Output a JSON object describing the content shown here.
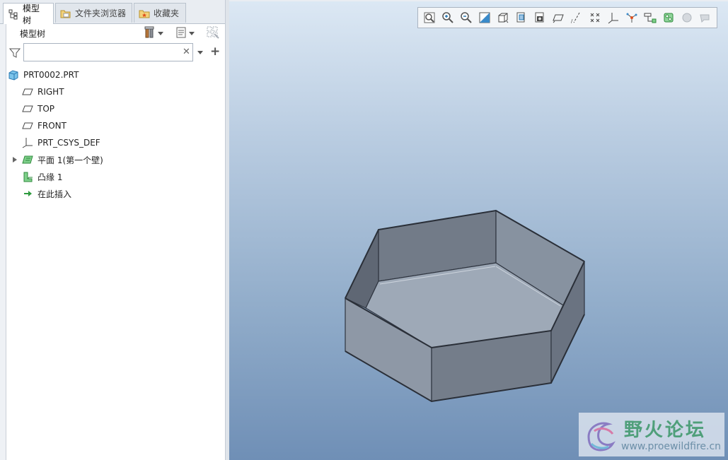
{
  "tabs": [
    {
      "label": "模型树",
      "icon": "model-tree-icon",
      "active": true
    },
    {
      "label": "文件夹浏览器",
      "icon": "folder-browser-icon",
      "active": false
    },
    {
      "label": "收藏夹",
      "icon": "favorites-icon",
      "active": false
    }
  ],
  "model_tree": {
    "title": "模型树",
    "search": {
      "value": "",
      "placeholder": ""
    },
    "items": [
      {
        "label": "PRT0002.PRT",
        "icon": "part-icon"
      },
      {
        "label": "RIGHT",
        "icon": "datum-plane-icon"
      },
      {
        "label": "TOP",
        "icon": "datum-plane-icon"
      },
      {
        "label": "FRONT",
        "icon": "datum-plane-icon"
      },
      {
        "label": "PRT_CSYS_DEF",
        "icon": "coordinate-system-icon"
      },
      {
        "label": "平面 1(第一个壁)",
        "icon": "planar-wall-icon",
        "expandable": true
      },
      {
        "label": "凸缘 1",
        "icon": "flange-icon"
      },
      {
        "label": "在此插入",
        "icon": "insert-here-arrow-icon"
      }
    ]
  },
  "view_toolbar": [
    "refit-icon",
    "zoom-in-icon",
    "zoom-out-icon",
    "repaint-icon",
    "display-style-icon",
    "saved-orientations-icon",
    "view-manager-icon",
    "plane-display-icon",
    "axis-display-icon",
    "point-display-icon",
    "csys-display-icon",
    "spin-center-icon",
    "annotation-display-icon",
    "appearance-icon",
    "disabled-circle-icon",
    "disabled-flag-icon"
  ],
  "watermark": {
    "title": "野火论坛",
    "url": "www.proewildfire.cn"
  },
  "colors": {
    "accent": "#3a8ac9",
    "model_fill": "#8f9aa8",
    "model_edge": "#2f3540",
    "viewport_top": "#dce8f4",
    "viewport_bottom": "#6f8fb6"
  }
}
